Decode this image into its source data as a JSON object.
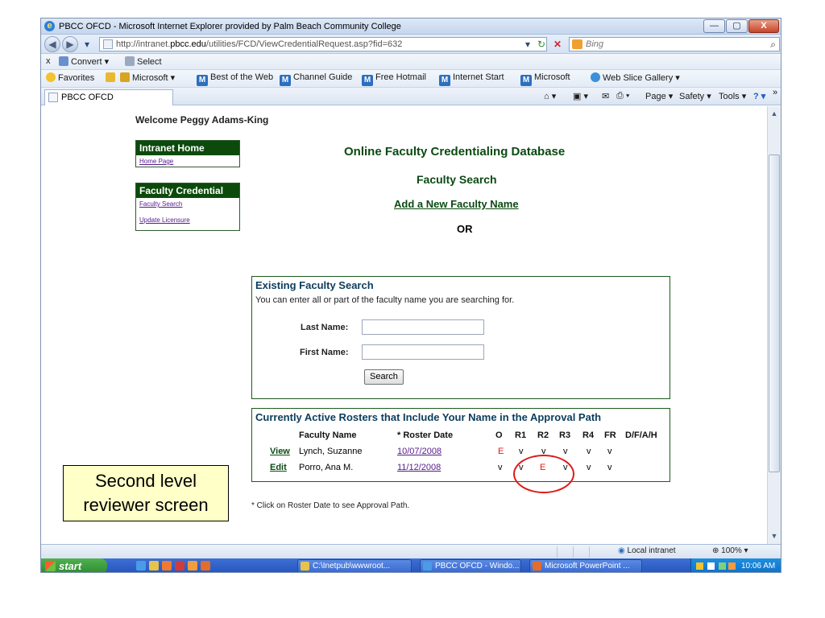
{
  "window": {
    "title": "PBCC OFCD - Microsoft Internet Explorer provided by Palm Beach Community College",
    "minimize_glyph": "—",
    "maximize_glyph": "▢",
    "close_glyph": "X"
  },
  "address_bar": {
    "url_prefix": "http://intranet.",
    "url_domain": "pbcc.edu",
    "url_path": "/utilities/FCD/ViewCredentialRequest.asp?fid=632",
    "search_placeholder": "Bing",
    "dropdown_glyph": "▾",
    "refresh_glyph": "↻",
    "stop_glyph": "✕",
    "search_go_glyph": "⌕"
  },
  "convert_bar": {
    "close_glyph": "x",
    "convert_label": "Convert",
    "select_label": "Select"
  },
  "favorites_bar": {
    "favorites_label": "Favorites",
    "items": [
      "Microsoft ▾",
      "Best of the Web",
      "Channel Guide",
      "Free Hotmail",
      "Internet Start",
      "Microsoft",
      "Web Slice Gallery ▾"
    ]
  },
  "tab": {
    "label": "PBCC OFCD"
  },
  "command_bar": {
    "page_label": "Page ▾",
    "safety_label": "Safety ▾",
    "tools_label": "Tools ▾",
    "help_label": "? ▾",
    "overflow_glyph": "»"
  },
  "page": {
    "welcome": "Welcome Peggy Adams-King",
    "nav": {
      "home_header": "Intranet Home",
      "home_link": "Home Page",
      "credential_header": "Faculty Credential",
      "faculty_search_link": "Faculty Search",
      "update_link": "Update Licensure"
    },
    "heading_main": "Online Faculty Credentialing Database",
    "heading_search": "Faculty Search",
    "add_link": "Add a New Faculty Name",
    "or_label": "OR",
    "search_panel": {
      "title": "Existing Faculty Search",
      "description": "You can enter all or part of the faculty name you are searching for.",
      "last_name_label": "Last Name:",
      "first_name_label": "First Name:",
      "last_name_value": "",
      "first_name_value": "",
      "search_button": "Search"
    },
    "roster_panel": {
      "title": "Currently Active Rosters that Include Your Name in the Approval Path",
      "columns": [
        "Faculty Name",
        "* Roster Date",
        "O",
        "R1",
        "R2",
        "R3",
        "R4",
        "FR",
        "D/F/A/H"
      ],
      "rows": [
        {
          "action": "View",
          "name": "Lynch, Suzanne",
          "date": "10/07/2008",
          "O": "E",
          "R1": "v",
          "R2": "v",
          "R3": "v",
          "R4": "v",
          "FR": "v",
          "DFAH": ""
        },
        {
          "action": "Edit",
          "name": "Porro, Ana M.",
          "date": "11/12/2008",
          "O": "v",
          "R1": "v",
          "R2": "E",
          "R3": "v",
          "R4": "v",
          "FR": "v",
          "DFAH": ""
        }
      ]
    },
    "note": "* Click on Roster Date to see Approval Path."
  },
  "status_bar": {
    "zone": "Local intranet",
    "zoom": "100%",
    "zoom_dropdown": "▾"
  },
  "taskbar": {
    "start_label": "start",
    "tasks": [
      "C:\\Inetpub\\wwwroot...",
      "PBCC OFCD - Windo...",
      "Microsoft PowerPoint ..."
    ],
    "clock": "10:06 AM"
  },
  "callout": {
    "line1": "Second level",
    "line2": "reviewer screen"
  },
  "colors": {
    "nav_header_bg": "#0c4a0c",
    "heading_green": "#0b4a12",
    "error_red": "#e01818",
    "callout_bg": "#ffffc8"
  }
}
